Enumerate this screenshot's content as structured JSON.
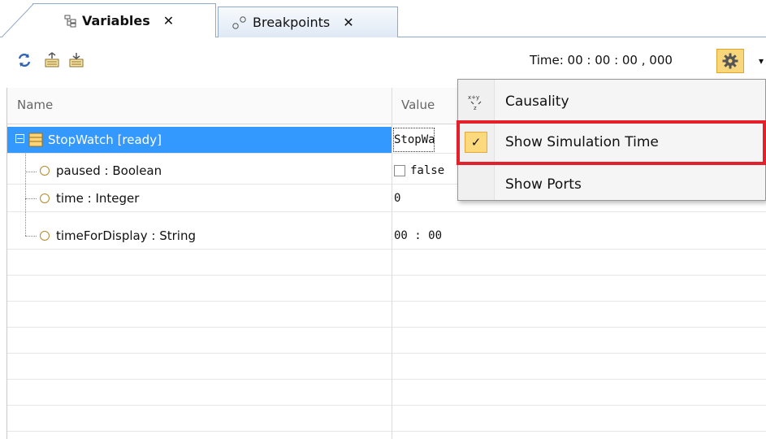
{
  "tabs": [
    {
      "label": "Variables",
      "icon": "tree-structure-icon",
      "active": true
    },
    {
      "label": "Breakpoints",
      "icon": "breakpoints-icon",
      "active": false
    }
  ],
  "toolbar": {
    "time_text": "Time: 00 : 00 : 00 , 000",
    "icons": [
      "refresh-icon",
      "expand-all-icon",
      "collapse-all-icon",
      "gear-icon"
    ]
  },
  "table": {
    "columns": [
      "Name",
      "Value"
    ],
    "rows": [
      {
        "name": "StopWatch [ready]",
        "value": "StopWa",
        "level": 0,
        "selected": true,
        "icon": "class-icon"
      },
      {
        "name": "paused : Boolean",
        "value": "false",
        "level": 1,
        "checkbox": true,
        "icon": "property-icon"
      },
      {
        "name": "time : Integer",
        "value": "0",
        "level": 1,
        "icon": "property-icon"
      },
      {
        "name": "timeForDisplay : String",
        "value": "00 : 00",
        "level": 1,
        "icon": "property-icon"
      }
    ]
  },
  "menu": {
    "items": [
      {
        "label": "Causality",
        "icon": "causality-icon",
        "checked": false
      },
      {
        "label": "Show Simulation Time",
        "icon": "check-icon",
        "checked": true
      },
      {
        "label": "Show Ports",
        "icon": "",
        "checked": false
      }
    ]
  },
  "colors": {
    "selection": "#3399ff",
    "highlight": "#e3202b",
    "accent": "#f8d77c"
  }
}
